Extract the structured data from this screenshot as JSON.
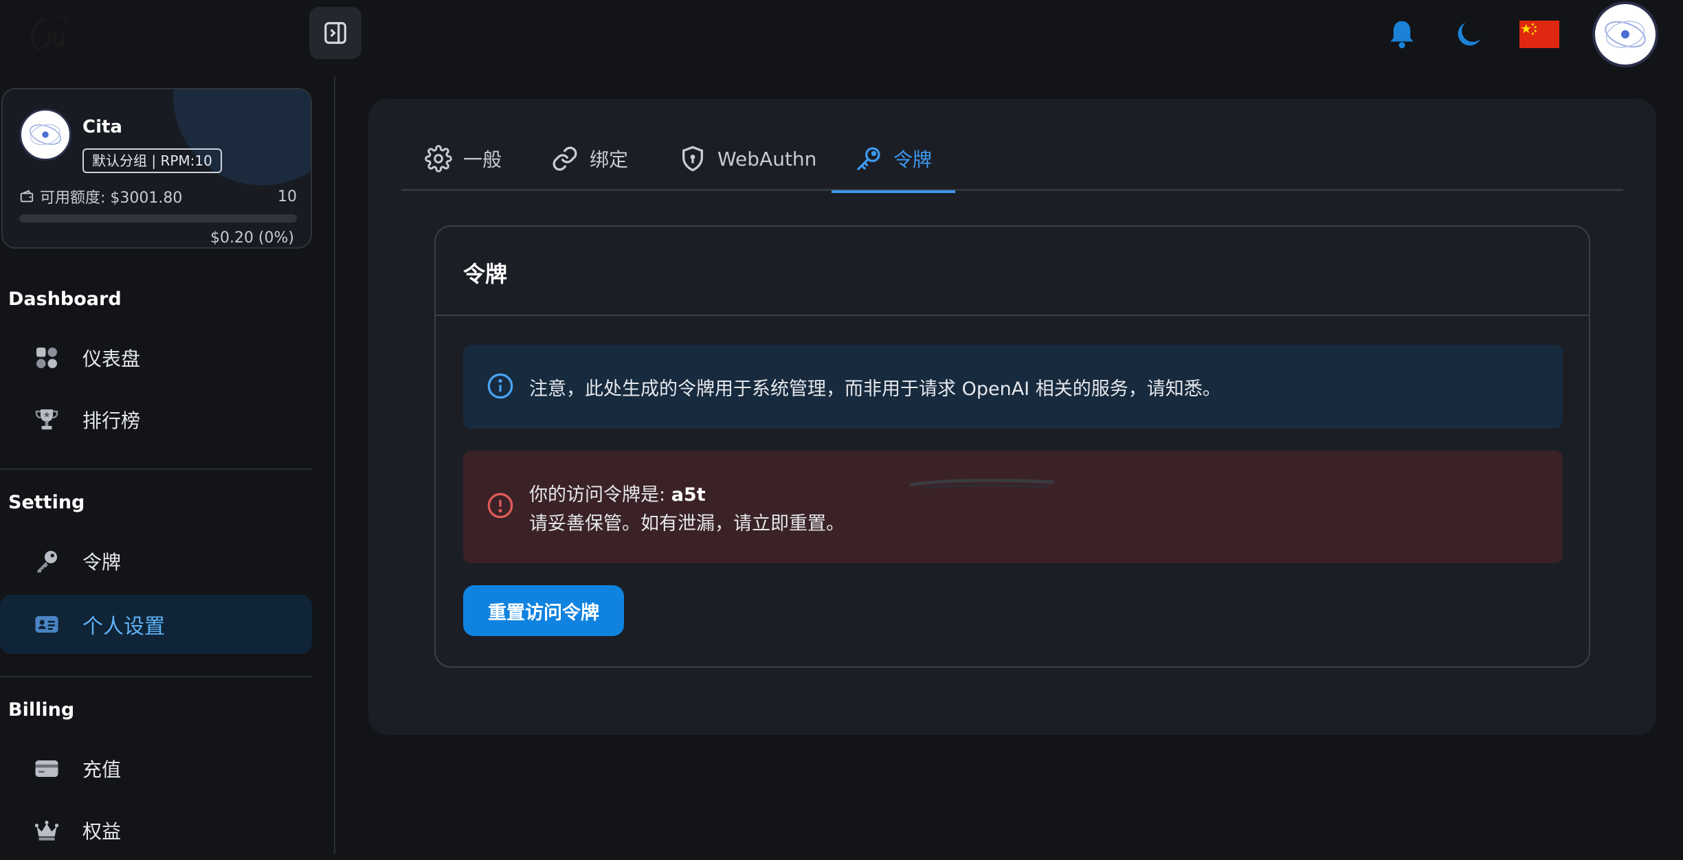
{
  "header": {
    "language_flag": "zh-CN",
    "icons": [
      "bell-icon",
      "moon-icon"
    ]
  },
  "user_card": {
    "name": "Cita",
    "group_badge": "默认分组 | RPM:10",
    "quota_label": "可用额度: $3001.80",
    "quota_count": "10",
    "usage_text": "$0.20 (0%)",
    "usage_percent": 0
  },
  "sidebar": {
    "sections": [
      {
        "title": "Dashboard",
        "items": [
          {
            "label": "仪表盘",
            "icon": "dashboard-icon"
          },
          {
            "label": "排行榜",
            "icon": "trophy-icon"
          }
        ]
      },
      {
        "title": "Setting",
        "items": [
          {
            "label": "令牌",
            "icon": "key-icon"
          },
          {
            "label": "个人设置",
            "icon": "id-card-icon",
            "active": true
          }
        ]
      },
      {
        "title": "Billing",
        "items": [
          {
            "label": "充值",
            "icon": "credit-card-icon"
          },
          {
            "label": "权益",
            "icon": "crown-icon"
          }
        ]
      }
    ]
  },
  "tabs": [
    {
      "label": "一般",
      "icon": "gear-icon"
    },
    {
      "label": "绑定",
      "icon": "link-icon"
    },
    {
      "label": "WebAuthn",
      "icon": "shield-icon"
    },
    {
      "label": "令牌",
      "icon": "key-icon",
      "active": true
    }
  ],
  "card": {
    "title": "令牌",
    "info_text": "注意，此处生成的令牌用于系统管理，而非用于请求 OpenAI 相关的服务，请知悉。",
    "warn_prefix": "你的访问令牌是: ",
    "token_visible": "a5t",
    "warn_line2": "请妥善保管。如有泄漏，请立即重置。",
    "reset_button": "重置访问令牌"
  },
  "colors": {
    "accent": "#3d9af0",
    "button": "#1083e0",
    "info_bg": "#172a3e",
    "warn_bg": "#3a2226",
    "warn_icon": "#e05a5a"
  }
}
